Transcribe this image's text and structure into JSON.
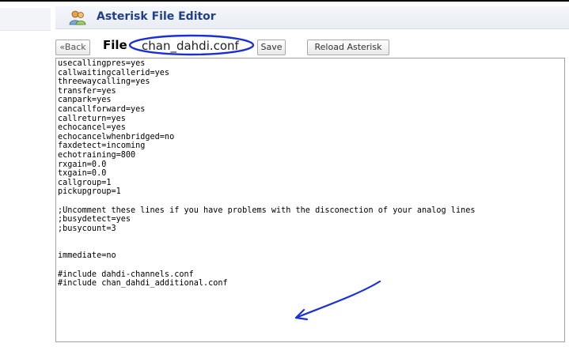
{
  "app": {
    "title": "Asterisk File Editor"
  },
  "toolbar": {
    "back_label": "«Back",
    "file_label": "File",
    "file_name": "chan_dahdi.conf",
    "save_label": "Save",
    "reload_label": "Reload Asterisk"
  },
  "editor": {
    "content": "usecallingpres=yes\ncallwaitingcallerid=yes\nthreewaycalling=yes\ntransfer=yes\ncanpark=yes\ncancallforward=yes\ncallreturn=yes\nechocancel=yes\nechocancelwhenbridged=no\nfaxdetect=incoming\nechotraining=800\nrxgain=0.0\ntxgain=0.0\ncallgroup=1\npickupgroup=1\n\n;Uncomment these lines if you have problems with the disconection of your analog lines\n;busydetect=yes\n;busycount=3\n\n\nimmediate=no\n\n#include dahdi-channels.conf\n#include chan_dahdi_additional.conf"
  },
  "annotations": {
    "highlight_color": "#1a2fd6"
  }
}
